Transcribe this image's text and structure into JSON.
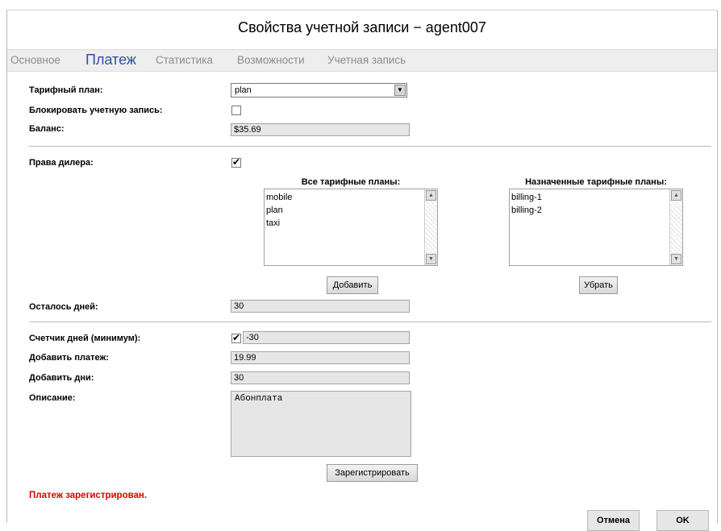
{
  "window": {
    "title": "Свойства учетной записи − agent007"
  },
  "tabs": [
    {
      "label": "Основное"
    },
    {
      "label": "Платеж"
    },
    {
      "label": "Статистика"
    },
    {
      "label": "Возможности"
    },
    {
      "label": "Учетная запись"
    }
  ],
  "form": {
    "tariff_plan_label": "Тарифный план:",
    "tariff_plan_value": "plan",
    "block_account_label": "Блокировать учетную запись:",
    "balance_label": "Баланс:",
    "balance_value": "$35.69",
    "dealer_rights_label": "Права дилера:",
    "all_plans_label": "Все тарифные планы:",
    "all_plans": [
      "mobile",
      "plan",
      "taxi"
    ],
    "assigned_plans_label": "Назначенные тарифные планы:",
    "assigned_plans": [
      "billing-1",
      "billing-2"
    ],
    "add_button": "Добавить",
    "remove_button": "Убрать",
    "days_left_label": "Осталось дней:",
    "days_left_value": "30",
    "day_counter_label": "Счетчик дней (минимум):",
    "day_counter_value": "-30",
    "add_payment_label": "Добавить платеж:",
    "add_payment_value": "19.99",
    "add_days_label": "Добавить дни:",
    "add_days_value": "30",
    "description_label": "Описание:",
    "description_value": "Абонплата",
    "register_button": "Зарегистрировать"
  },
  "status_message": "Платеж зарегистрирован.",
  "footer": {
    "cancel": "Отмена",
    "ok": "OK"
  },
  "colors": {
    "status": "#e00000",
    "active_tab": "#2f4fa3"
  }
}
